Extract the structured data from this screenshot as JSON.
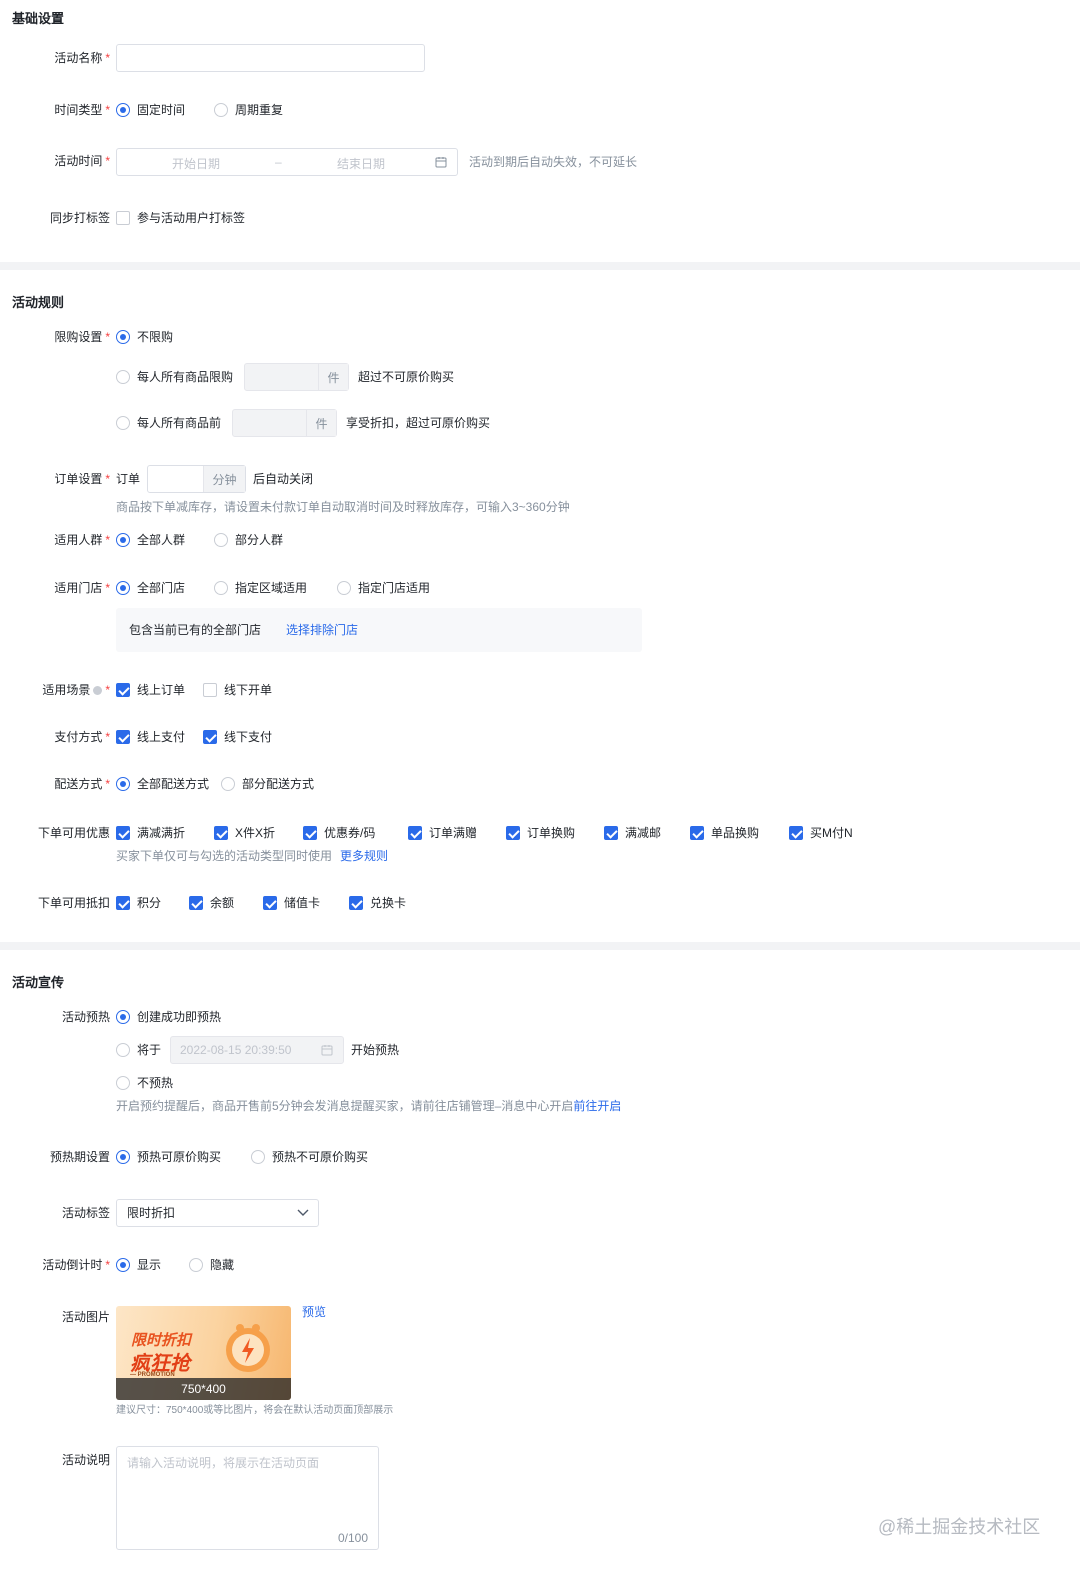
{
  "basic": {
    "title": "基础设置",
    "activity_name": {
      "label": "活动名称",
      "value": ""
    },
    "time_type": {
      "label": "时间类型",
      "options": [
        "固定时间",
        "周期重复"
      ]
    },
    "activity_time": {
      "label": "活动时间",
      "start_placeholder": "开始日期",
      "sep": "–",
      "end_placeholder": "结束日期",
      "hint": "活动到期后自动失效，不可延长"
    },
    "sync_tag": {
      "label": "同步打标签",
      "option": "参与活动用户打标签"
    }
  },
  "rules": {
    "title": "活动规则",
    "limit": {
      "label": "限购设置",
      "opt_none": "不限购",
      "opt_all": "每人所有商品限购",
      "unit": "件",
      "opt_all_suffix": "超过不可原价购买",
      "opt_before": "每人所有商品前",
      "opt_before_suffix": "享受折扣，超过可原价购买"
    },
    "order": {
      "label": "订单设置",
      "prefix": "订单",
      "unit": "分钟",
      "suffix": "后自动关闭",
      "hint": "商品按下单减库存，请设置未付款订单自动取消时间及时释放库存，可输入3~360分钟"
    },
    "crowd": {
      "label": "适用人群",
      "options": [
        "全部人群",
        "部分人群"
      ]
    },
    "store": {
      "label": "适用门店",
      "options": [
        "全部门店",
        "指定区域适用",
        "指定门店适用"
      ],
      "box_text": "包含当前已有的全部门店",
      "box_link": "选择排除门店"
    },
    "scene": {
      "label": "适用场景",
      "options": [
        "线上订单",
        "线下开单"
      ]
    },
    "pay": {
      "label": "支付方式",
      "options": [
        "线上支付",
        "线下支付"
      ]
    },
    "delivery": {
      "label": "配送方式",
      "options": [
        "全部配送方式",
        "部分配送方式"
      ]
    },
    "discounts": {
      "label": "下单可用优惠",
      "options": [
        "满减满折",
        "X件X折",
        "优惠券/码",
        "订单满赠",
        "订单换购",
        "满减邮",
        "单品换购",
        "买M付N"
      ],
      "hint": "买家下单仅可与勾选的活动类型同时使用",
      "link": "更多规则"
    },
    "deduct": {
      "label": "下单可用抵扣",
      "options": [
        "积分",
        "余额",
        "储值卡",
        "兑换卡"
      ]
    }
  },
  "promo": {
    "title": "活动宣传",
    "preheat": {
      "label": "活动预热",
      "opt_now": "创建成功即预热",
      "opt_at": "将于",
      "datetime": "2022-08-15 20:39:50",
      "opt_at_suffix": "开始预热",
      "opt_none": "不预热",
      "hint": "开启预约提醒后，商品开售前5分钟会发消息提醒买家，请前往店铺管理–消息中心开启",
      "hint_link": "前往开启"
    },
    "preheat_period": {
      "label": "预热期设置",
      "options": [
        "预热可原价购买",
        "预热不可原价购买"
      ]
    },
    "tag": {
      "label": "活动标签",
      "value": "限时折扣"
    },
    "countdown": {
      "label": "活动倒计时",
      "options": [
        "显示",
        "隐藏"
      ]
    },
    "image": {
      "label": "活动图片",
      "preview": "预览",
      "banner_line1": "限时折扣",
      "banner_line2": "疯狂抢",
      "banner_sub": "— PROMOTION",
      "size": "750*400",
      "hint": "建议尺寸：750*400或等比图片，将会在默认活动页面顶部展示"
    },
    "desc": {
      "label": "活动说明",
      "placeholder": "请输入活动说明，将展示在活动页面",
      "count": "0/100"
    }
  },
  "watermark": "@稀土掘金技术社区",
  "colors": {
    "primary": "#2a6ae9",
    "required": "#f53f3f",
    "muted": "#86909c",
    "divider": "#f2f3f5"
  }
}
